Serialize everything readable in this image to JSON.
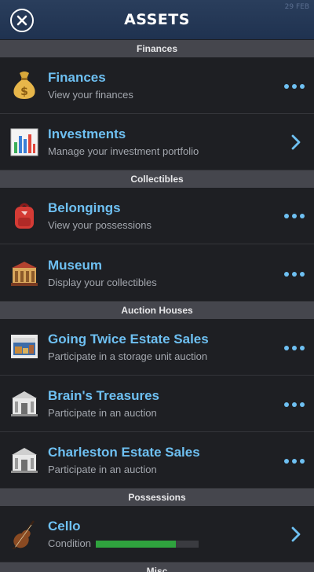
{
  "header": {
    "title": "ASSETS",
    "corner_text": "29 FEB"
  },
  "sections": {
    "finances": {
      "title": "Finances"
    },
    "collectibles": {
      "title": "Collectibles"
    },
    "auction_houses": {
      "title": "Auction Houses"
    },
    "possessions": {
      "title": "Possessions"
    },
    "misc": {
      "title": "Misc"
    }
  },
  "rows": {
    "finances": {
      "label": "Finances",
      "sub": "View your finances",
      "icon": "money-bag-icon",
      "action": "more-icon"
    },
    "investments": {
      "label": "Investments",
      "sub": "Manage your investment portfolio",
      "icon": "bar-chart-icon",
      "action": "chevron-right-icon"
    },
    "belongings": {
      "label": "Belongings",
      "sub": "View your possessions",
      "icon": "backpack-icon",
      "action": "more-icon"
    },
    "museum": {
      "label": "Museum",
      "sub": "Display your collectibles",
      "icon": "museum-icon",
      "action": "more-icon"
    },
    "going_twice": {
      "label": "Going Twice Estate Sales",
      "sub": "Participate in a storage unit auction",
      "icon": "storage-unit-icon",
      "action": "more-icon"
    },
    "brains_treasures": {
      "label": "Brain's Treasures",
      "sub": "Participate in an auction",
      "icon": "auction-building-icon",
      "action": "more-icon"
    },
    "charleston": {
      "label": "Charleston Estate Sales",
      "sub": "Participate in an auction",
      "icon": "auction-building-icon",
      "action": "more-icon"
    },
    "cello": {
      "label": "Cello",
      "condition_label": "Condition",
      "condition_value": 0.78,
      "icon": "cello-icon",
      "action": "chevron-right-icon"
    }
  },
  "colors": {
    "accent": "#6ec0f2",
    "header_bg": "#243855",
    "section_bg": "#45464d",
    "row_bg": "#1e1f23",
    "progress": "#2fa33e"
  }
}
